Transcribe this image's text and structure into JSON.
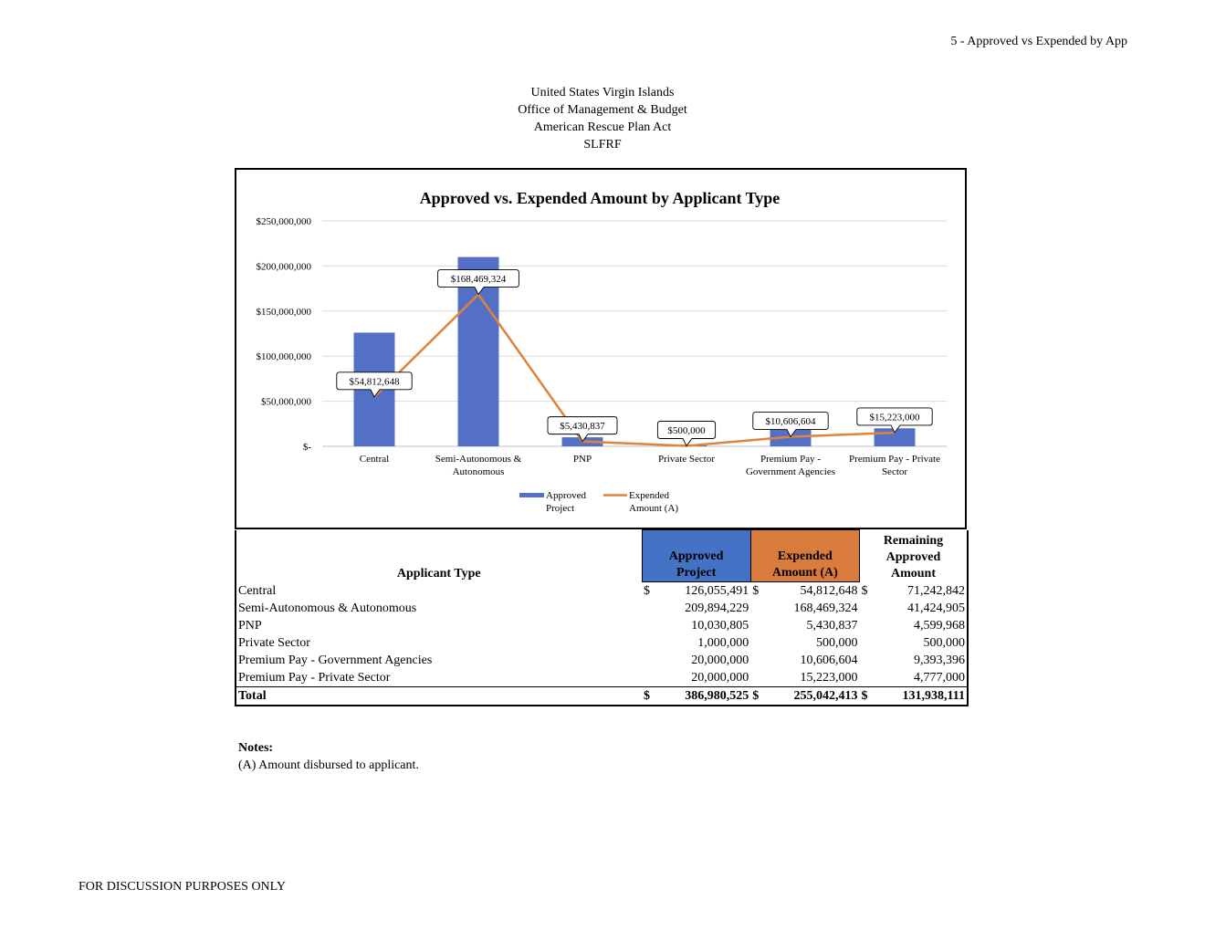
{
  "page_label": "5 - Approved vs Expended by App",
  "header": {
    "line1": "United States Virgin Islands",
    "line2": "Office of Management & Budget",
    "line3": "American Rescue Plan Act",
    "line4": "SLFRF"
  },
  "colors": {
    "approved": "#5470c6",
    "expended": "#e0823a",
    "grid": "#d9d9d9"
  },
  "chart_data": {
    "type": "bar",
    "title": "Approved vs. Expended Amount by Applicant Type",
    "categories": [
      "Central",
      "Semi-Autonomous & Autonomous",
      "PNP",
      "Private Sector",
      "Premium Pay - Government Agencies",
      "Premium Pay - Private Sector"
    ],
    "category_lines": [
      [
        "Central"
      ],
      [
        "Semi-Autonomous &",
        "Autonomous"
      ],
      [
        "PNP"
      ],
      [
        "Private Sector"
      ],
      [
        "Premium Pay -",
        "Government Agencies"
      ],
      [
        "Premium Pay - Private",
        "Sector"
      ]
    ],
    "series": [
      {
        "name": "Approved Project",
        "kind": "bar",
        "values": [
          126055491,
          209894229,
          10030805,
          1000000,
          20000000,
          20000000
        ]
      },
      {
        "name": "Expended Amount (A)",
        "kind": "line",
        "values": [
          54812648,
          168469324,
          5430837,
          500000,
          10606604,
          15223000
        ]
      }
    ],
    "data_labels": [
      "$54,812,648",
      "$168,469,324",
      "$5,430,837",
      "$500,000",
      "$10,606,604",
      "$15,223,000"
    ],
    "ylim": [
      0,
      250000000
    ],
    "yticks": [
      0,
      50000000,
      100000000,
      150000000,
      200000000,
      250000000
    ],
    "ytick_labels": [
      "$-",
      "$50,000,000",
      "$100,000,000",
      "$150,000,000",
      "$200,000,000",
      "$250,000,000"
    ],
    "legend_lines": [
      [
        "Approved",
        "Project"
      ],
      [
        "Expended",
        "Amount (A)"
      ]
    ],
    "legend_position": "bottom",
    "grid": true
  },
  "table": {
    "headers": {
      "applicant_type": "Applicant Type",
      "approved": [
        "Approved",
        "Project"
      ],
      "expended": [
        "Expended",
        "Amount (A)"
      ],
      "remaining": [
        "Remaining",
        "Approved",
        "Amount"
      ]
    },
    "rows": [
      {
        "type": "Central",
        "approved": "126,055,491",
        "expended": "54,812,648",
        "remaining": "71,242,842",
        "dollar": "$"
      },
      {
        "type": "Semi-Autonomous & Autonomous",
        "approved": "209,894,229",
        "expended": "168,469,324",
        "remaining": "41,424,905",
        "dollar": ""
      },
      {
        "type": "PNP",
        "approved": "10,030,805",
        "expended": "5,430,837",
        "remaining": "4,599,968",
        "dollar": ""
      },
      {
        "type": "Private Sector",
        "approved": "1,000,000",
        "expended": "500,000",
        "remaining": "500,000",
        "dollar": ""
      },
      {
        "type": "Premium Pay - Government Agencies",
        "approved": "20,000,000",
        "expended": "10,606,604",
        "remaining": "9,393,396",
        "dollar": ""
      },
      {
        "type": "Premium Pay - Private Sector",
        "approved": "20,000,000",
        "expended": "15,223,000",
        "remaining": "4,777,000",
        "dollar": ""
      }
    ],
    "total": {
      "type": "Total",
      "dollar": "$",
      "approved": "386,980,525",
      "expended": "255,042,413",
      "remaining": "131,938,111"
    }
  },
  "notes": {
    "title": "Notes:",
    "line1": "(A) Amount disbursed to applicant."
  },
  "footer": "FOR DISCUSSION PURPOSES ONLY"
}
